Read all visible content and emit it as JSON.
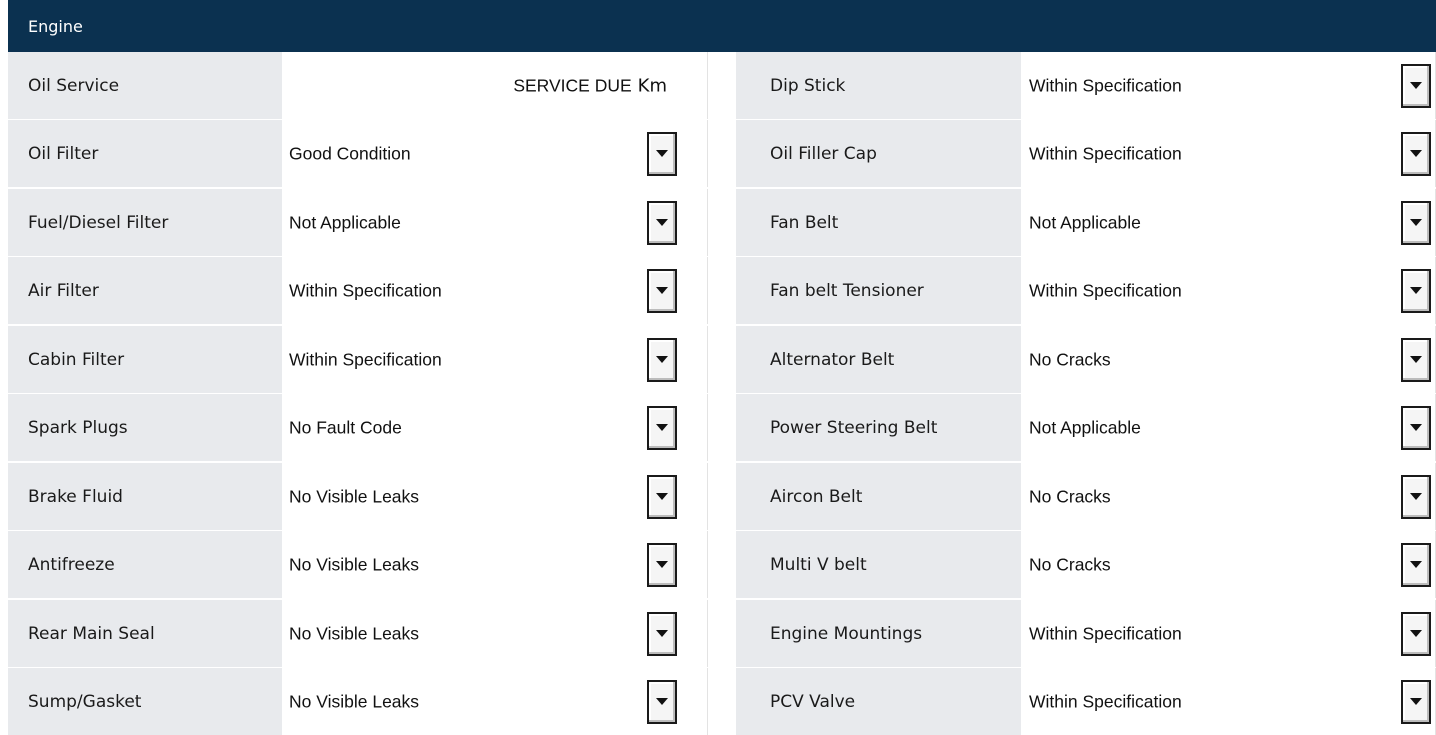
{
  "section_title": "Engine",
  "left": [
    {
      "label": "Oil Service",
      "service_text": "SERVICE DUE",
      "unit": "Km"
    },
    {
      "label": "Oil Filter",
      "value": "Good Condition"
    },
    {
      "label": "Fuel/Diesel Filter",
      "value": "Not Applicable"
    },
    {
      "label": "Air Filter",
      "value": "Within Specification"
    },
    {
      "label": "Cabin Filter",
      "value": "Within Specification"
    },
    {
      "label": "Spark Plugs",
      "value": "No Fault Code"
    },
    {
      "label": "Brake Fluid",
      "value": "No Visible Leaks"
    },
    {
      "label": "Antifreeze",
      "value": "No Visible Leaks"
    },
    {
      "label": "Rear Main Seal",
      "value": "No Visible Leaks"
    },
    {
      "label": "Sump/Gasket",
      "value": "No Visible Leaks"
    }
  ],
  "right": [
    {
      "label": "Dip Stick",
      "value": "Within Specification"
    },
    {
      "label": "Oil Filler Cap",
      "value": "Within Specification"
    },
    {
      "label": "Fan Belt",
      "value": "Not Applicable"
    },
    {
      "label": "Fan belt Tensioner",
      "value": "Within Specification"
    },
    {
      "label": "Alternator Belt",
      "value": "No Cracks"
    },
    {
      "label": "Power Steering Belt",
      "value": "Not Applicable"
    },
    {
      "label": "Aircon Belt",
      "value": "No Cracks"
    },
    {
      "label": "Multi V belt",
      "value": "No Cracks"
    },
    {
      "label": "Engine Mountings",
      "value": "Within Specification"
    },
    {
      "label": "PCV Valve",
      "value": "Within Specification"
    }
  ],
  "colors": {
    "header": "#0b3150",
    "label_bg": "#e8eaed"
  },
  "icons": {
    "dropdown": "dropdown-arrow-icon"
  }
}
